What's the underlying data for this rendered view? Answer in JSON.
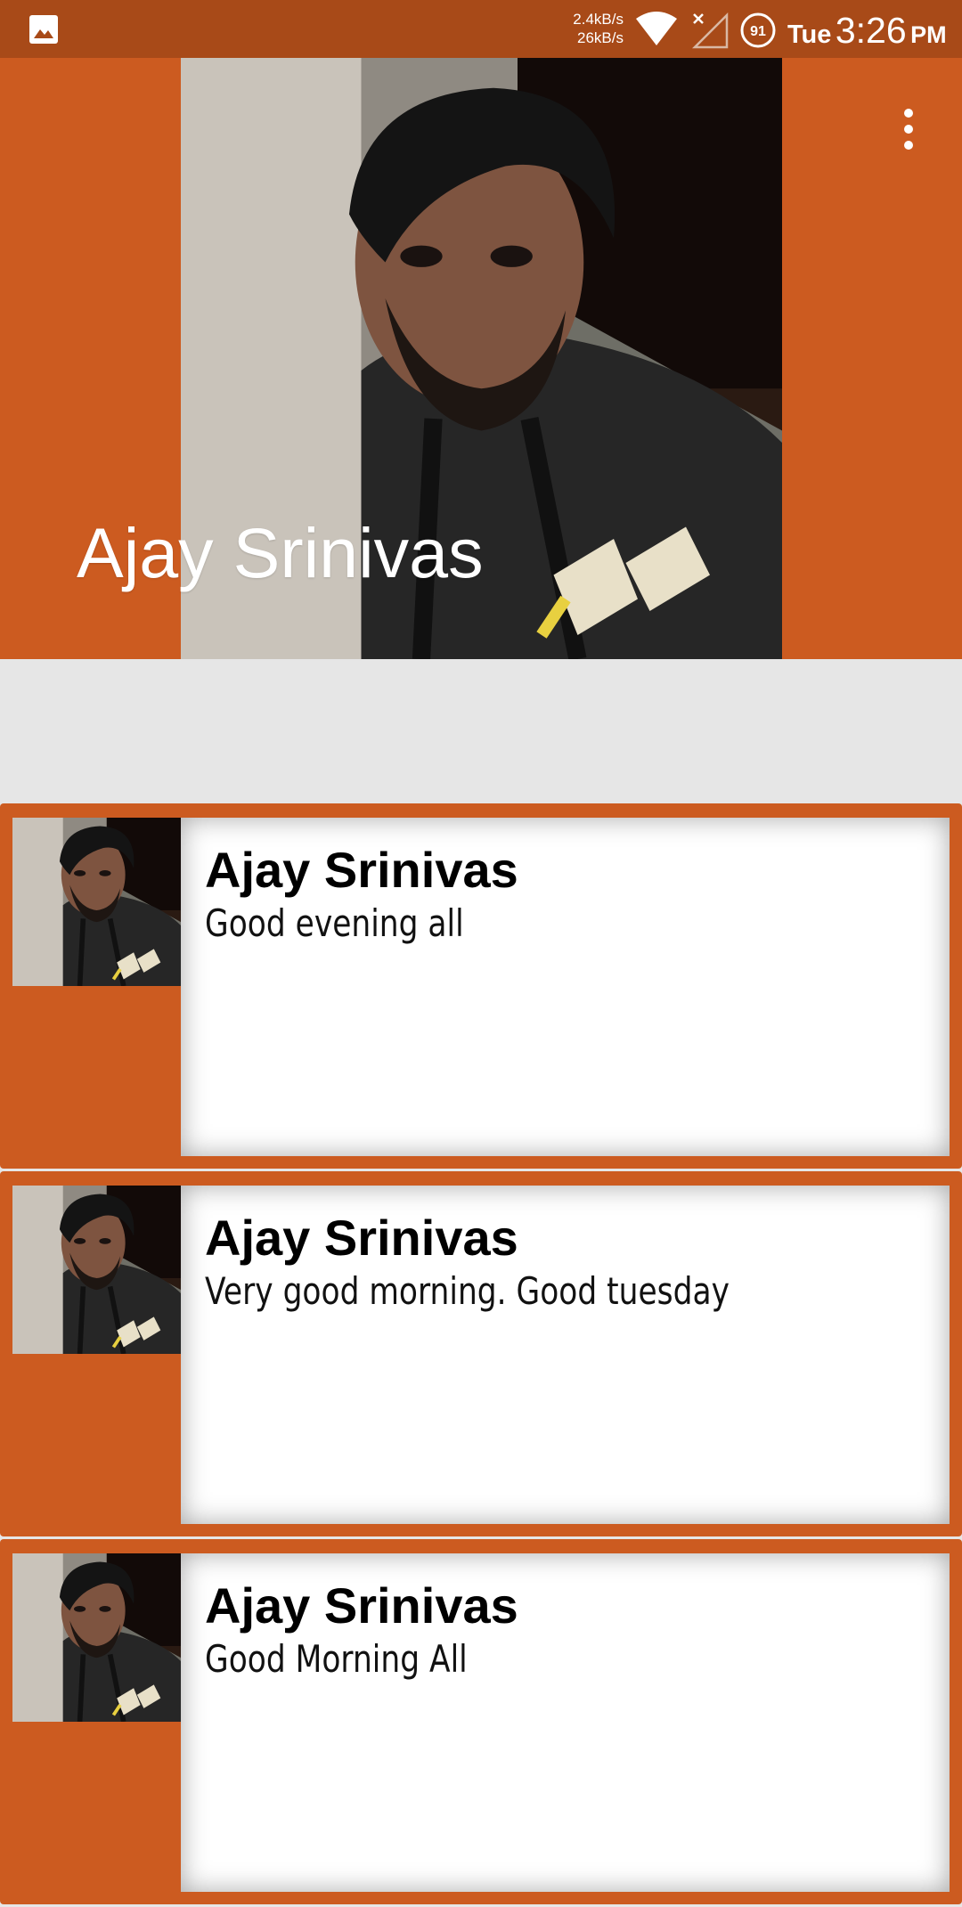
{
  "status_bar": {
    "net_up": "2.4kB/s",
    "net_down": "26kB/s",
    "battery_level": "91",
    "day": "Tue",
    "time": "3:26",
    "ampm": "PM",
    "icons": [
      "gallery-notification-icon",
      "wifi-icon",
      "no-signal-icon",
      "battery-icon"
    ]
  },
  "header": {
    "name": "Ajay Srinivas",
    "menu_icon": "overflow-menu-icon",
    "background_color": "#cc5b20"
  },
  "feed": {
    "posts": [
      {
        "author": "Ajay Srinivas",
        "message": "Good evening all"
      },
      {
        "author": "Ajay Srinivas",
        "message": "Very good morning. Good tuesday"
      },
      {
        "author": "Ajay Srinivas",
        "message": "Good Morning All"
      }
    ]
  },
  "colors": {
    "status_bar": "#a84a18",
    "accent": "#cc5b20",
    "background": "#e6e6e6"
  }
}
